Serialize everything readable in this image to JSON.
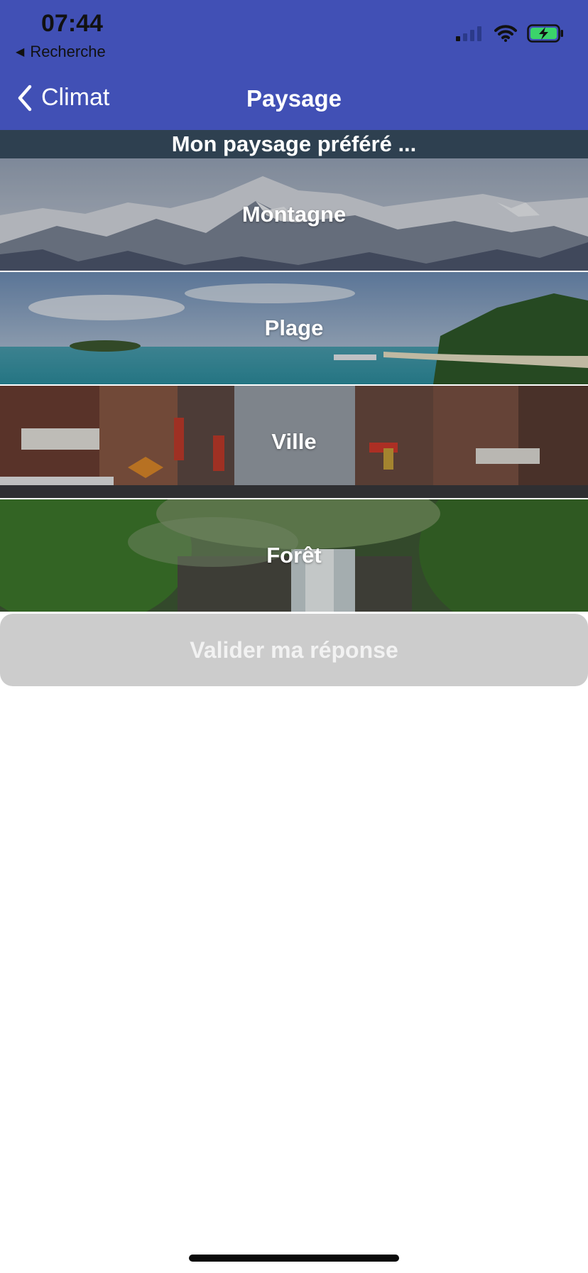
{
  "status_bar": {
    "time": "07:44",
    "back_label": "Recherche",
    "back_icon": "triangle-left-icon",
    "icons": [
      "cellular-signal-icon",
      "wifi-icon",
      "battery-charging-icon"
    ]
  },
  "nav": {
    "back_label": "Climat",
    "back_icon": "chevron-left-icon",
    "title": "Paysage"
  },
  "question": {
    "prompt": "Mon paysage préféré ..."
  },
  "options": [
    {
      "label": "Montagne"
    },
    {
      "label": "Plage"
    },
    {
      "label": "Ville"
    },
    {
      "label": "Forêt"
    }
  ],
  "actions": {
    "validate_label": "Valider ma réponse"
  },
  "colors": {
    "header": "#4150b5",
    "prompt_bar": "#2e4050",
    "button_disabled": "#cccccc",
    "battery_fill": "#3bd46a"
  }
}
